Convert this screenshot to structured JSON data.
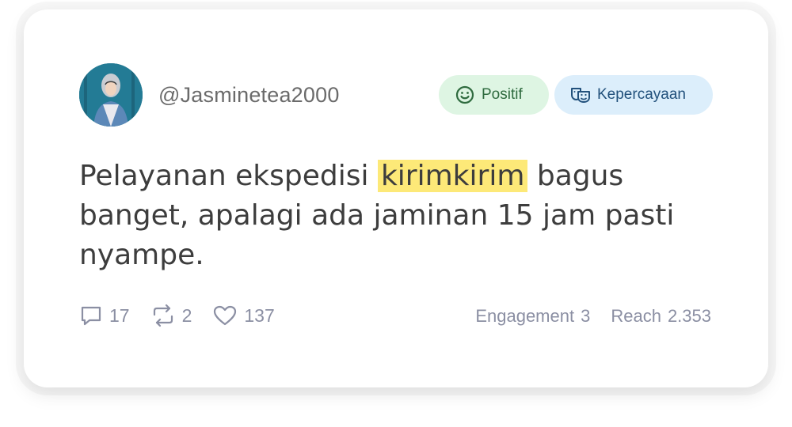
{
  "post": {
    "username": "@Jasminetea2000",
    "badges": [
      {
        "label": "Positif",
        "icon": "smiley-icon",
        "bg": "#def5e3",
        "color": "#2f6b3f"
      },
      {
        "label": "Kepercayaan",
        "icon": "theater-masks-icon",
        "bg": "#dceefb",
        "color": "#22517c"
      }
    ],
    "text_before": "Pelayanan ekspedisi ",
    "text_highlight": "kirimkirim",
    "text_after": " bagus banget, apalagi ada jaminan 15 jam pasti nyampe.",
    "highlight_color": "#fde978",
    "stats": {
      "comments": "17",
      "retweets": "2",
      "likes": "137"
    },
    "metrics": {
      "engagement_label": "Engagement",
      "engagement_value": "3",
      "reach_label": "Reach",
      "reach_value": "2.353"
    }
  }
}
